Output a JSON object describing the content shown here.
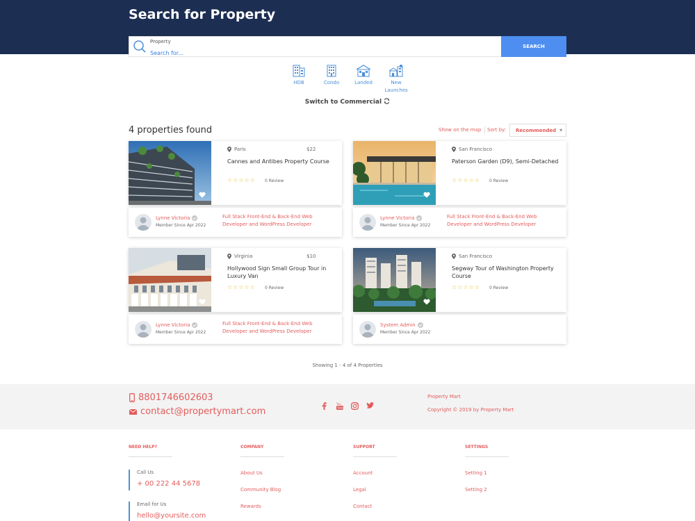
{
  "header": {
    "title": "Search for Property"
  },
  "search": {
    "label": "Property",
    "placeholder": "Search for...",
    "button": "SEARCH"
  },
  "types": [
    {
      "label": "HDB",
      "icon": "building-icon"
    },
    {
      "label": "Condo",
      "icon": "condo-icon"
    },
    {
      "label": "Landed",
      "icon": "house-icon"
    },
    {
      "label": "New Launches",
      "icon": "new-launches-icon"
    }
  ],
  "switch": {
    "label": "Switch to Commercial"
  },
  "results": {
    "count_text": "4 properties found",
    "show_map": "Show on the map",
    "sort_label": "Sort by:",
    "sort_value": "Recommended"
  },
  "listings": [
    {
      "location": "Paris",
      "price": "$22",
      "title": "Cannes and Antibes Property Course",
      "stars": "☆☆☆☆☆",
      "reviews": "0 Review",
      "owner": "Lynne Victoria",
      "since": "Member Since Apr 2022",
      "role": "Full Stack Front-End & Back-End Web Developer and WordPress Developer"
    },
    {
      "location": "San Francisco",
      "price": "",
      "title": "Paterson Garden (D9), Semi-Detached",
      "stars": "☆☆☆☆☆",
      "reviews": "0 Review",
      "owner": "Lynne Victoria",
      "since": "Member Since Apr 2022",
      "role": "Full Stack Front-End & Back-End Web Developer and WordPress Developer"
    },
    {
      "location": "Virginia",
      "price": "$10",
      "title": "Hollywood Sign Small Group Tour in Luxury Van",
      "stars": "☆☆☆☆☆",
      "reviews": "0 Review",
      "owner": "Lynne Victoria",
      "since": "Member Since Apr 2022",
      "role": "Full Stack Front-End & Back-End Web Developer and WordPress Developer"
    },
    {
      "location": "San Francisco",
      "price": "",
      "title": "Segway Tour of Washington Property Course",
      "stars": "☆☆☆☆☆",
      "reviews": "0 Review",
      "owner": "System Admin",
      "since": "Member Since Apr 2022",
      "role": ""
    }
  ],
  "pagination": {
    "text": "Showing 1 - 4 of 4 Properties"
  },
  "footer": {
    "phone": "8801746602603",
    "email": "contact@propertymart.com",
    "social": [
      "facebook-icon",
      "youtube-icon",
      "instagram-icon",
      "twitter-icon"
    ],
    "brand": "Property Mart",
    "copyright": "Copyright © 2019 by Property Mart",
    "columns": {
      "help": {
        "heading": "NEED HELP?",
        "call_label": "Call Us",
        "call_value": "+ 00 222 44 5678",
        "email_label": "Email for Us",
        "email_value": "hello@yoursite.com"
      },
      "company": {
        "heading": "COMPANY",
        "links": [
          "About Us",
          "Community Blog",
          "Rewards"
        ]
      },
      "support": {
        "heading": "SUPPORT",
        "links": [
          "Account",
          "Legal",
          "Contact"
        ]
      },
      "settings": {
        "heading": "SETTINGS",
        "links": [
          "Setting 1",
          "Setting 2"
        ]
      }
    }
  },
  "colors": {
    "header_bg": "#1c2e52",
    "accent": "#e45b5b",
    "button": "#4d8ef0",
    "link_blue": "#4a8fd8"
  }
}
